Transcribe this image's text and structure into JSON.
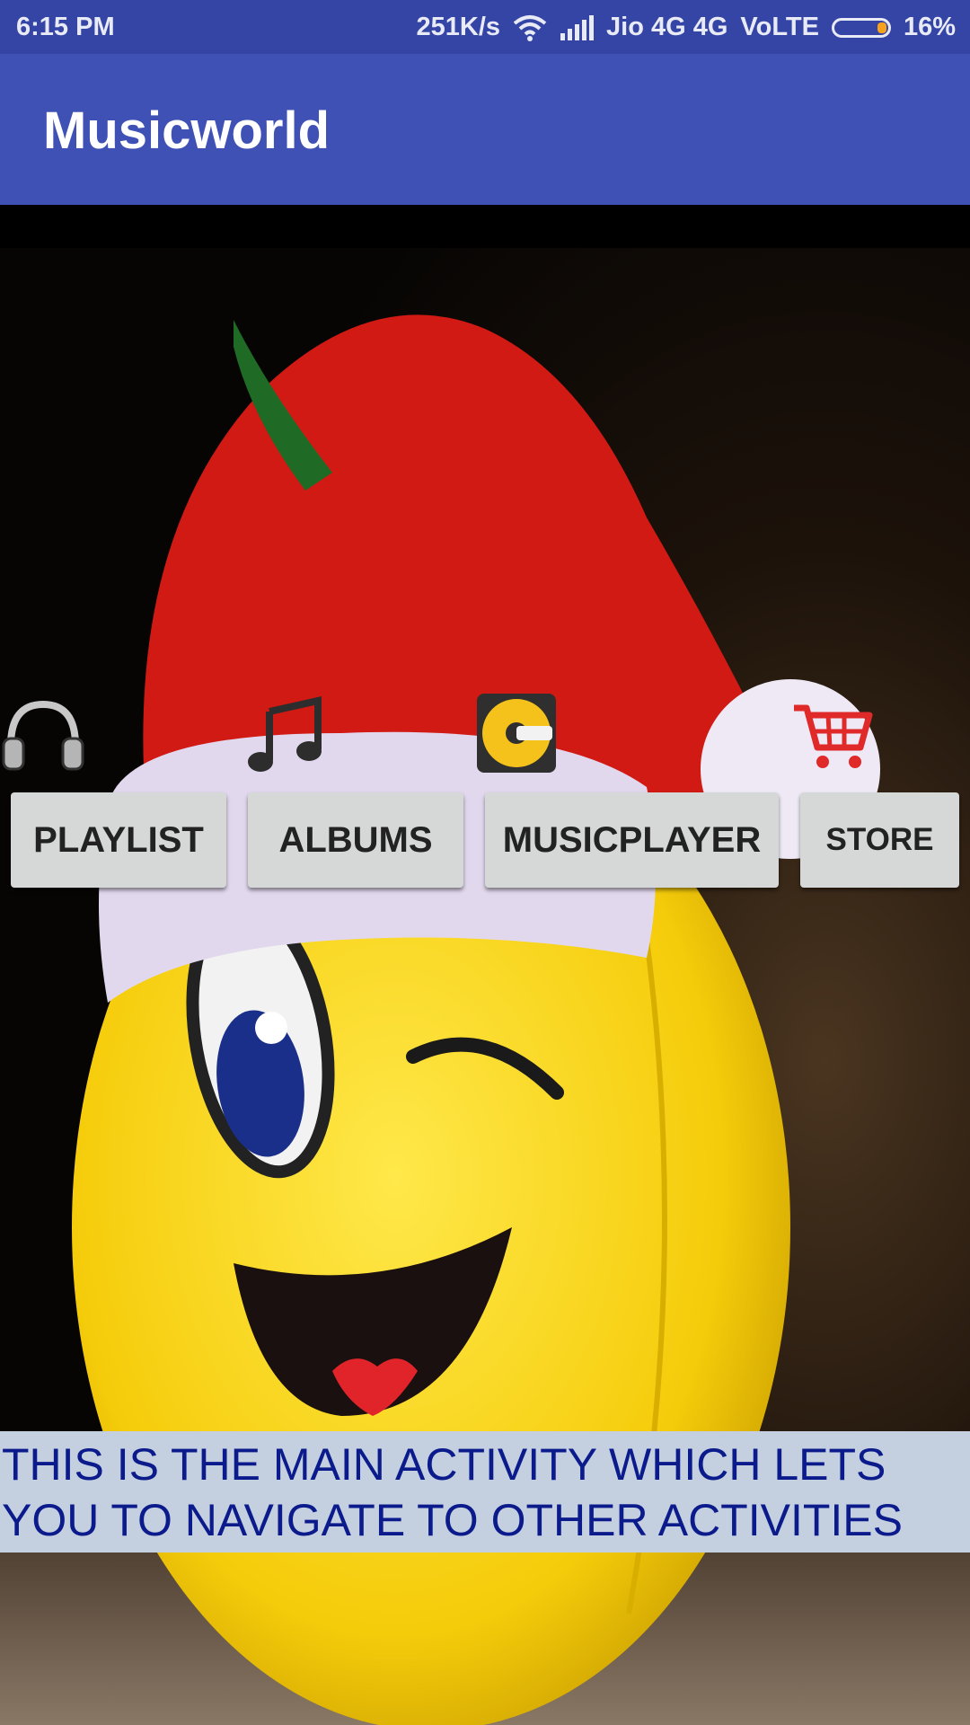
{
  "status_bar": {
    "time": "6:15 PM",
    "speed": "251K/s",
    "carrier": "Jio 4G 4G",
    "volte": "VoLTE",
    "battery": "16%",
    "icons": [
      "wifi-icon",
      "signal-icon",
      "battery-icon"
    ]
  },
  "app_bar": {
    "title": "Musicworld"
  },
  "nav": {
    "playlist": {
      "label": "PLAYLIST",
      "icon": "headphones-icon"
    },
    "albums": {
      "label": "ALBUMS",
      "icon": "music-note-icon"
    },
    "musicplayer": {
      "label": "MUSICPLAYER",
      "icon": "disc-player-icon"
    },
    "store": {
      "label": "STORE",
      "icon": "shopping-cart-icon"
    }
  },
  "banner": {
    "text": "THIS IS THE MAIN ACTIVITY WHICH LETS YOU TO NAVIGATE TO OTHER ACTIVITIES"
  },
  "colors": {
    "status_bar": "#3545a6",
    "app_bar": "#3f51b5",
    "button_bg": "#d6d7d7",
    "banner_bg": "#c4cfe0",
    "banner_text": "#0b1b8c"
  }
}
